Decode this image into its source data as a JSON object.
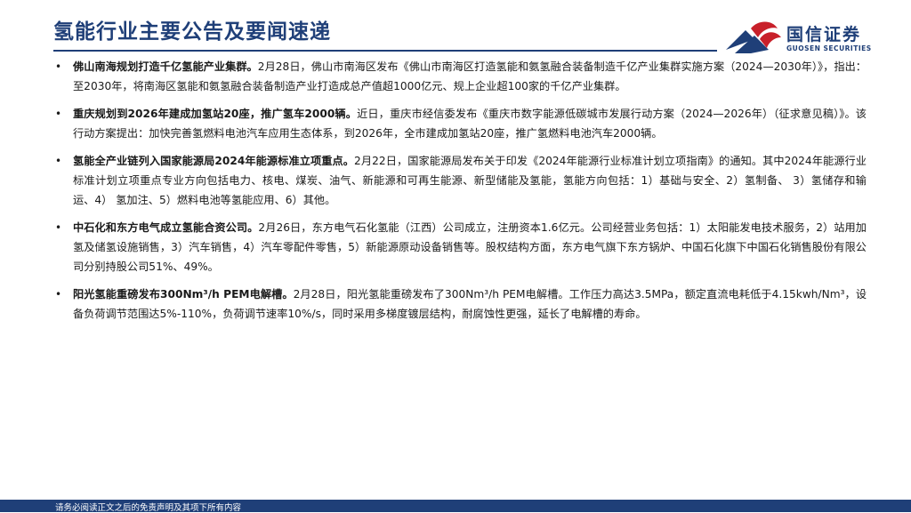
{
  "header": {
    "title": "氢能行业主要公告及要闻速递"
  },
  "logo": {
    "name_cn": "国信证券",
    "name_en": "GUOSEN SECURITIES",
    "colors": {
      "red": "#c8202a",
      "blue": "#1f3f78"
    }
  },
  "items": [
    {
      "bullet": "•",
      "head": "佛山南海规划打造千亿氢能产业集群。",
      "body": "2月28日，佛山市南海区发布《佛山市南海区打造氢能和氨氢融合装备制造千亿产业集群实施方案（2024—2030年）》，指出：至2030年，将南海区氢能和氨氢融合装备制造产业打造成总产值超1000亿元、规上企业超100家的千亿产业集群。"
    },
    {
      "bullet": "•",
      "head": "重庆规划到2026年建成加氢站20座，推广氢车2000辆。",
      "body": "近日，重庆市经信委发布《重庆市数字能源低碳城市发展行动方案（2024—2026年）（征求意见稿）》。该行动方案提出：加快完善氢燃料电池汽车应用生态体系，到2026年，全市建成加氢站20座，推广氢燃料电池汽车2000辆。"
    },
    {
      "bullet": "•",
      "head": "氢能全产业链列入国家能源局2024年能源标准立项重点。",
      "body": "2月22日，国家能源局发布关于印发《2024年能源行业标准计划立项指南》的通知。其中2024年能源行业标准计划立项重点专业方向包括电力、核电、煤炭、油气、新能源和可再生能源、新型储能及氢能，氢能方向包括：1）基础与安全、2）氢制备、 3）氢储存和输运、4） 氢加注、5）燃料电池等氢能应用、6）其他。"
    },
    {
      "bullet": "•",
      "head": "中石化和东方电气成立氢能合资公司。",
      "body": "2月26日，东方电气石化氢能（江西）公司成立，注册资本1.6亿元。公司经营业务包括：1）太阳能发电技术服务，2）站用加氢及储氢设施销售，3）汽车销售，4）汽车零配件零售，5）新能源原动设备销售等。股权结构方面，东方电气旗下东方锅炉、中国石化旗下中国石化销售股份有限公司分别持股公司51%、49%。"
    },
    {
      "bullet": "•",
      "head": "阳光氢能重磅发布300Nm³/h PEM电解槽。",
      "body": "2月28日，阳光氢能重磅发布了300Nm³/h PEM电解槽。工作压力高达3.5MPa，额定直流电耗低于4.15kwh/Nm³，设备负荷调节范围达5%-110%，负荷调节速率10%/s，同时采用多梯度镀层结构，耐腐蚀性更强，延长了电解槽的寿命。"
    }
  ],
  "footer": {
    "disclaimer": "请务必阅读正文之后的免责声明及其项下所有内容"
  }
}
